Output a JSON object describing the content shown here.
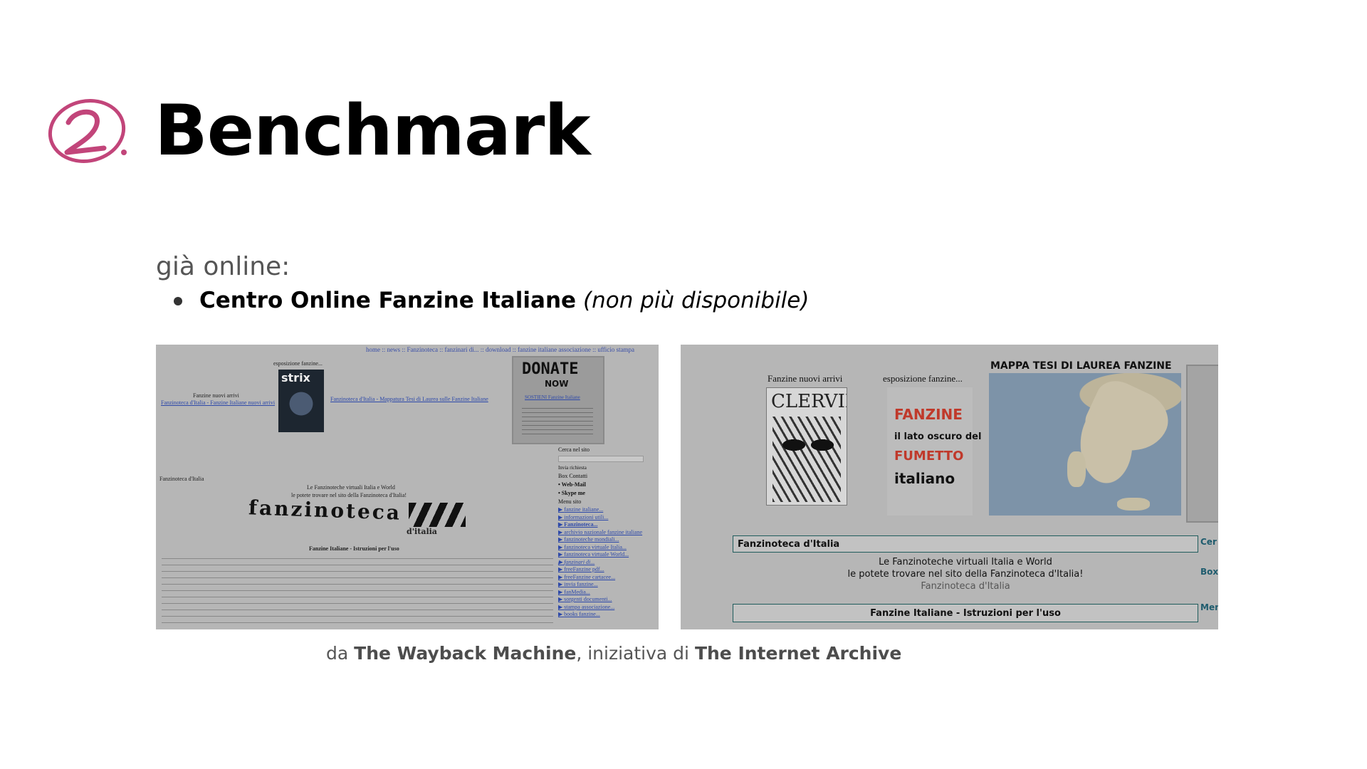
{
  "header": {
    "number_badge": "2.",
    "title": "Benchmark"
  },
  "content": {
    "subheading": "già online:",
    "bullet_strong": "Centro Online Fanzine Italiane",
    "bullet_em": "(non più disponibile)"
  },
  "caption": {
    "prefix": "da ",
    "source": "The Wayback Machine",
    "middle": ", iniziativa di ",
    "org": "The Internet Archive"
  },
  "screenshot1": {
    "nav_links": "home :: news :: Fanzinoteca :: fanzinari di... :: download :: fanzine italiane associazione :: ufficio stampa",
    "expo_label": "esposizione fanzine...",
    "comic_title": "strix",
    "nuovi_arrivi": "Fanzine nuovi arrivi",
    "nuovi_link": "Fanzinoteca d'Italia - Fanzine Italiane nuovi arrivi",
    "mappa_link": "Fanzinoteca d'Italia - Mappatura Tesi di Laurea sulle Fanzine Italiane",
    "donate": "DONATE",
    "donate_now": "NOW",
    "donate_link": "SOSTIENI Fanzine Italiane",
    "fanzinoteca_label": "Fanzinoteca d'Italia",
    "line1": "Le Fanzinoteche virtuali Italia e World",
    "line2": "le potete trovare nel sito della Fanzinoteca d'Italia!",
    "logo_text": "fanzinoteca",
    "logo_sub": "d'italia",
    "istruzioni": "Fanzine Italiane - Istruzioni per l'uso",
    "search_label": "Cerca nel sito",
    "invia": "Invia richiesta",
    "box_contatti": "Box Contatti",
    "webmail": "• Web-Mail",
    "skype": "• Skype me",
    "menu": "Menu sito",
    "menu_items": [
      "fanzine italiane...",
      "informazioni utili...",
      "Fanzinoteca...",
      "archivio nazionale fanzine italiane",
      "fanzinoteche mondiali...",
      "fanzinoteca virtuale Italia...",
      "fanzinoteca virtuale World...",
      "fanzinari di...",
      "freeFanzine pdf...",
      "freeFanzine cartacee...",
      "invia fanzine...",
      "fanMedia...",
      "sorgenti documenti...",
      "stampa associazione...",
      "books fanzine..."
    ]
  },
  "screenshot2": {
    "nuovi_arrivi": "Fanzine nuovi arrivi",
    "comic_title": "CLERVILLE",
    "expo_label": "esposizione fanzine...",
    "fanzine_word": "FANZINE",
    "lato": "il lato oscuro del",
    "fumetto": "FUMETTO",
    "italiano": "italiano",
    "map_title": "MAPPA TESI DI LAUREA FANZINE",
    "box_title": "Fanzinoteca d'Italia",
    "line1": "Le Fanzinoteche virtuali Italia e World",
    "line2": "le potete trovare nel sito della Fanzinoteca d'Italia!",
    "line3": "Fanzinoteca d'Italia",
    "istruzioni": "Fanzine Italiane - Istruzioni per l'uso",
    "side_cer": "Cer",
    "side_box": "Box",
    "side_men": "Men"
  },
  "colors": {
    "badge": "#c2457a",
    "caption_bold": "#4d4d4d",
    "screenshot_bg": "#b6b6b6",
    "box_border": "#1f5c5c"
  }
}
